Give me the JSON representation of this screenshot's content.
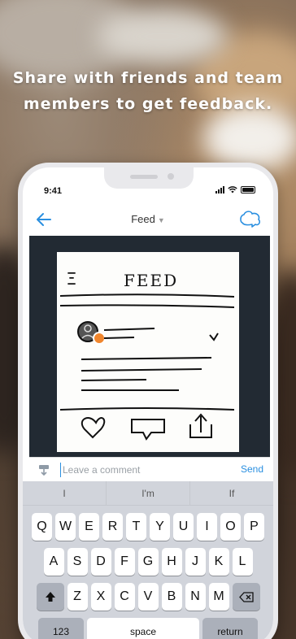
{
  "headline": {
    "line1": "Share with friends and team",
    "line2": "members to get feedback."
  },
  "status_bar": {
    "time": "9:41"
  },
  "nav": {
    "title": "Feed",
    "caret": "▼"
  },
  "sketch_text": {
    "title": "FEED",
    "menu_glyph": "Ξ"
  },
  "comment": {
    "placeholder": "Leave a comment",
    "send_label": "Send"
  },
  "keyboard": {
    "suggestions": [
      "I",
      "I'm",
      "If"
    ],
    "row1": [
      "Q",
      "W",
      "E",
      "R",
      "T",
      "Y",
      "U",
      "I",
      "O",
      "P"
    ],
    "row2": [
      "A",
      "S",
      "D",
      "F",
      "G",
      "H",
      "J",
      "K",
      "L"
    ],
    "row3": [
      "Z",
      "X",
      "C",
      "V",
      "B",
      "N",
      "M"
    ],
    "numbers_label": "123",
    "space_label": "space",
    "return_label": "return"
  },
  "colors": {
    "accent": "#2a8fe0",
    "avatar_dot": "#f0862e",
    "photo_bg": "#222a33"
  }
}
